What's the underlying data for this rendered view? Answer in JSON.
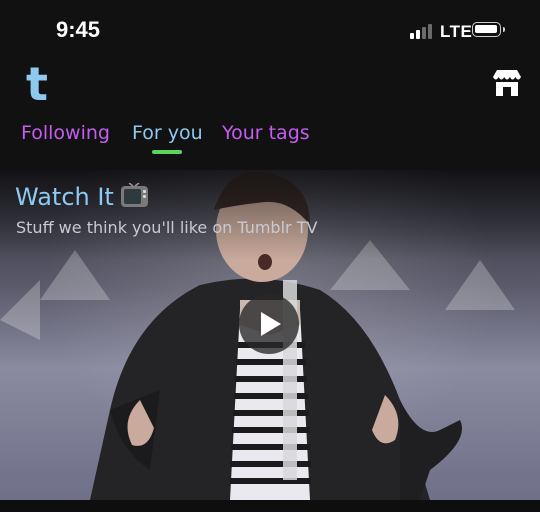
{
  "status_bar": {
    "time": "9:45",
    "network": "LTE"
  },
  "header": {
    "logo_letter": "t",
    "shop_icon": "storefront-icon"
  },
  "tabs": [
    {
      "label": "Following",
      "active": false
    },
    {
      "label": "For you",
      "active": true
    },
    {
      "label": "Your tags",
      "active": false
    }
  ],
  "card": {
    "title": "Watch It",
    "title_icon": "tv-icon",
    "subtitle": "Stuff we think you'll like on Tumblr TV",
    "play_icon": "play-icon"
  },
  "colors": {
    "background": "#111111",
    "brand_blue": "#8fc9f0",
    "tab_purple": "#c45df0",
    "active_indicator": "#5ad45f"
  }
}
